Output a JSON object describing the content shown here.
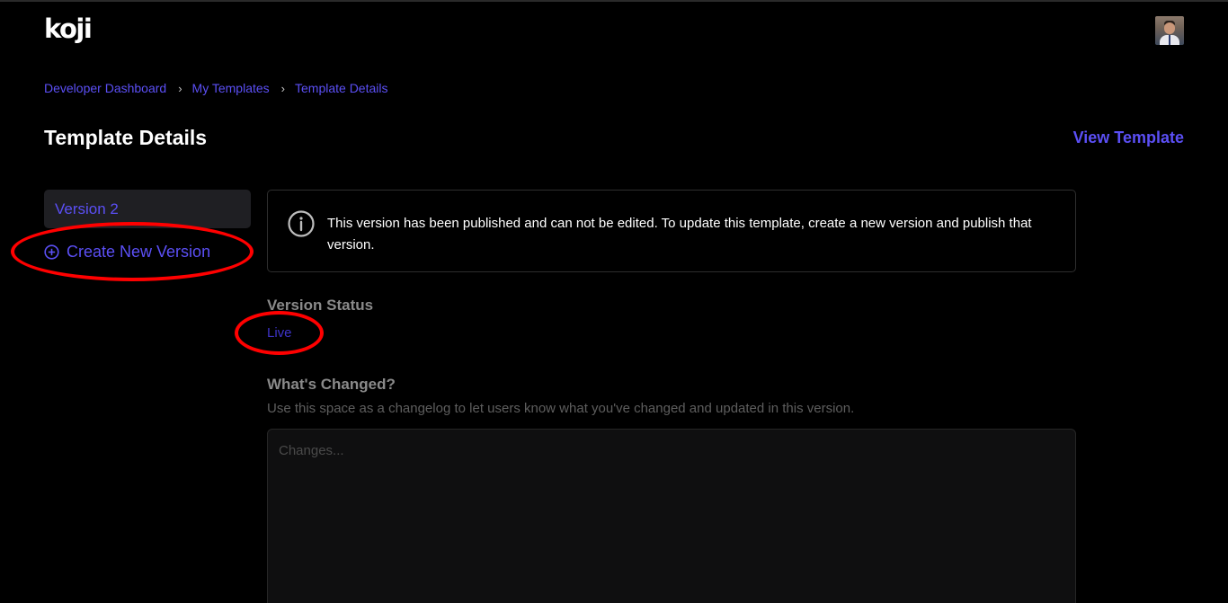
{
  "app": {
    "logo_text": "koji"
  },
  "header": {
    "avatar_alt": "user-avatar"
  },
  "breadcrumb": {
    "items": [
      "Developer Dashboard",
      "My Templates",
      "Template Details"
    ]
  },
  "page": {
    "title": "Template Details",
    "view_template_label": "View Template"
  },
  "sidebar": {
    "version_label": "Version 2",
    "create_label": "Create New Version"
  },
  "notice": {
    "text": "This version has been published and can not be edited. To update this template, create a new version and publish that version."
  },
  "status": {
    "label": "Version Status",
    "value": "Live"
  },
  "changes": {
    "label": "What's Changed?",
    "help": "Use this space as a changelog to let users know what you've changed and updated in this version.",
    "placeholder": "Changes...",
    "value": ""
  },
  "colors": {
    "accent": "#5b4ff5",
    "annotation": "#ff0000",
    "background": "#000000"
  },
  "icons": [
    "info-circle-icon",
    "plus-circle-icon",
    "chevron-right-icon"
  ]
}
